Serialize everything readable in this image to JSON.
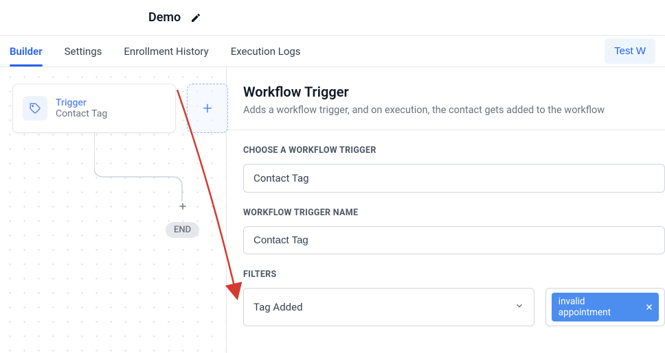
{
  "header": {
    "title": "Demo"
  },
  "tabs": {
    "builder": "Builder",
    "settings": "Settings",
    "enrollment": "Enrollment History",
    "logs": "Execution Logs",
    "test": "Test W"
  },
  "canvas": {
    "trigger_label": "Trigger",
    "trigger_sub": "Contact Tag",
    "end": "END"
  },
  "panel": {
    "title": "Workflow Trigger",
    "desc": "Adds a workflow trigger, and on execution, the contact gets added to the workflow",
    "choose_label": "CHOOSE A WORKFLOW TRIGGER",
    "choose_value": "Contact Tag",
    "name_label": "WORKFLOW TRIGGER NAME",
    "name_value": "Contact Tag",
    "filters_label": "FILTERS",
    "filter_value": "Tag Added",
    "chip_value": "invalid appointment"
  }
}
